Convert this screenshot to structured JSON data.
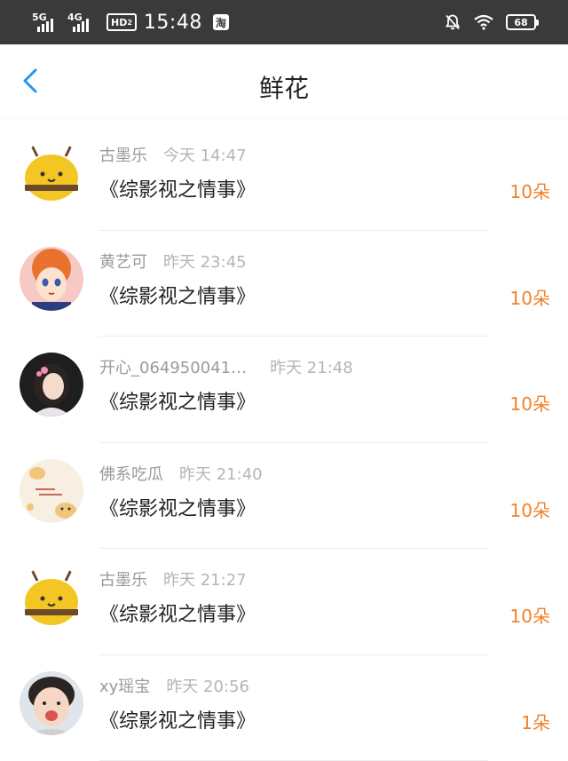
{
  "status_bar": {
    "network1": "5G",
    "network2": "4G",
    "hd_label": "HD",
    "hd_sub": "2",
    "time": "15:48",
    "taobao_icon_label": "淘",
    "battery": "68"
  },
  "header": {
    "title": "鲜花",
    "back_icon": "chevron-left-icon"
  },
  "colors": {
    "accent_orange": "#f0822a",
    "back_blue": "#2196f3",
    "status_bg": "#3a3a3a"
  },
  "records": [
    {
      "avatar": "bee-avatar",
      "name": "古墨乐",
      "date": "今天 14:47",
      "title": "《综影视之情事》",
      "count": "10朵"
    },
    {
      "avatar": "anime-girl-avatar",
      "name": "黄艺可",
      "date": "昨天 23:45",
      "title": "《综影视之情事》",
      "count": "10朵"
    },
    {
      "avatar": "photo-girl-avatar",
      "name": "开心_064950041…",
      "date": "昨天 21:48",
      "title": "《综影视之情事》",
      "count": "10朵"
    },
    {
      "avatar": "cat-doodle-avatar",
      "name": "佛系吃瓜",
      "date": "昨天 21:40",
      "title": "《综影视之情事》",
      "count": "10朵"
    },
    {
      "avatar": "bee-avatar",
      "name": "古墨乐",
      "date": "昨天 21:27",
      "title": "《综影视之情事》",
      "count": "10朵"
    },
    {
      "avatar": "child-photo-avatar",
      "name": "xy瑶宝",
      "date": "昨天 20:56",
      "title": "《综影视之情事》",
      "count": "1朵"
    }
  ]
}
